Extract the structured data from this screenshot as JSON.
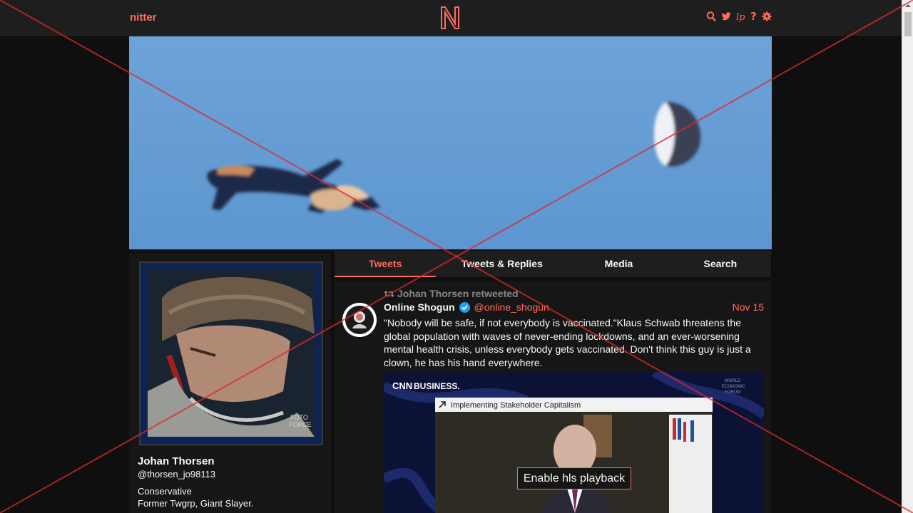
{
  "navbar": {
    "logo_text": "nitter",
    "icons": [
      "search-icon",
      "twitter-icon",
      "rss-icon",
      "help-icon",
      "settings-icon"
    ],
    "accent_color": "#ff6c60"
  },
  "profile": {
    "name": "Johan Thorsen",
    "handle": "@thorsen_jo98113",
    "bio_line1": "Conservative",
    "bio_line2": "Former Twgrp, Giant Slayer."
  },
  "tabs": {
    "tweets": "Tweets",
    "replies": "Tweets & Replies",
    "media": "Media",
    "search": "Search"
  },
  "tweet": {
    "retweet_label": "Johan Thorsen retweeted",
    "author_name": "Online Shogun",
    "author_handle": "@online_shogun",
    "date": "Nov 15",
    "text": "\"Nobody will be safe, if not everybody is vaccinated.\"Klaus Schwab threatens the global population with waves of never-ending lockdowns, and an ever-worsening mental health crisis, unless everybody gets vaccinated. Don't think this guy is just a clown, he has his hand everywhere.",
    "media_label": "Implementing Stakeholder Capitalism",
    "media_brand": "BUSINESS.",
    "media_forum": "WORLD ECONOMIC FORUM",
    "hls_button": "Enable hls playback"
  }
}
